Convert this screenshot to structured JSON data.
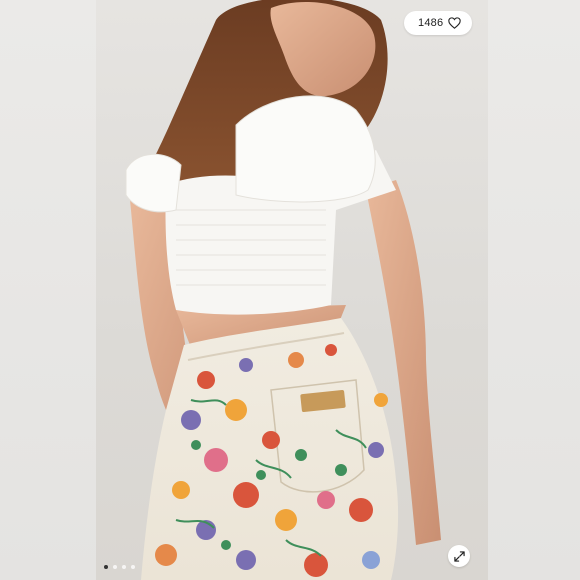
{
  "like": {
    "count": "1486",
    "icon": "heart-outline-icon"
  },
  "gallery": {
    "slides": 4,
    "active_slide": 1
  },
  "expand": {
    "icon": "expand-arrows-icon"
  },
  "colors": {
    "background": "#e9e8e6",
    "pill_background": "#ffffff",
    "active_dot": "#333333",
    "inactive_dot": "#ffffff"
  }
}
